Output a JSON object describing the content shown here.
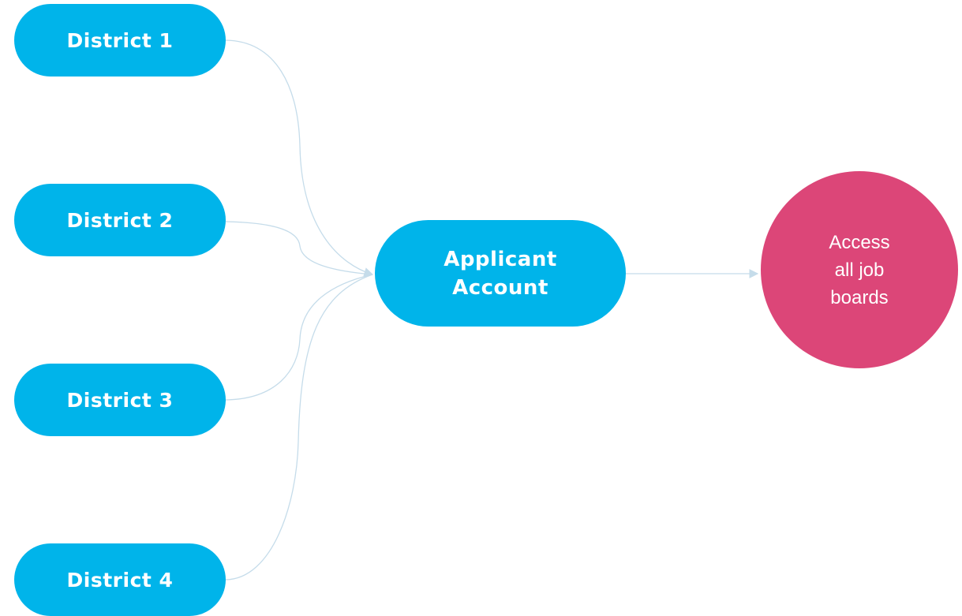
{
  "districts": [
    {
      "label": "District 1"
    },
    {
      "label": "District 2"
    },
    {
      "label": "District 3"
    },
    {
      "label": "District 4"
    }
  ],
  "applicant": {
    "line1": "Applicant",
    "line2": "Account"
  },
  "access": {
    "line1": "Access",
    "line2": "all job",
    "line3": "boards"
  },
  "colors": {
    "node_blue": "#00b4ea",
    "node_pink": "#dc4678",
    "connector": "#c5dcea",
    "text": "#ffffff"
  }
}
